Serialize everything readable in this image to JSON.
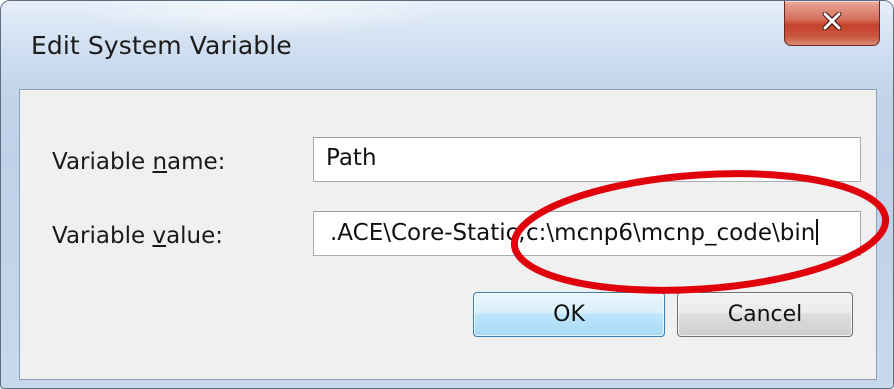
{
  "window": {
    "title": "Edit System Variable",
    "close_label": "X"
  },
  "form": {
    "name_label_prefix": "Variable ",
    "name_label_mnemonic": "n",
    "name_label_suffix": "ame:",
    "name_value": "Path",
    "value_label_prefix": "Variable ",
    "value_label_mnemonic": "v",
    "value_label_suffix": "alue:",
    "value_value": ".ACE\\Core-Static;c:\\mcnp6\\mcnp_code\\bin"
  },
  "buttons": {
    "ok_label": "OK",
    "cancel_label": "Cancel"
  },
  "annotation": {
    "shape": "ellipse",
    "color": "#e0000c"
  }
}
